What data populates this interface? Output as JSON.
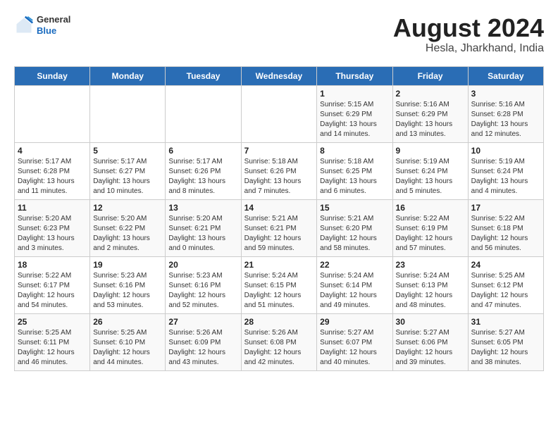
{
  "header": {
    "logo": {
      "general": "General",
      "blue": "Blue"
    },
    "title": "August 2024",
    "location": "Hesla, Jharkhand, India"
  },
  "weekdays": [
    "Sunday",
    "Monday",
    "Tuesday",
    "Wednesday",
    "Thursday",
    "Friday",
    "Saturday"
  ],
  "weeks": [
    [
      {
        "day": "",
        "info": ""
      },
      {
        "day": "",
        "info": ""
      },
      {
        "day": "",
        "info": ""
      },
      {
        "day": "",
        "info": ""
      },
      {
        "day": "1",
        "info": "Sunrise: 5:15 AM\nSunset: 6:29 PM\nDaylight: 13 hours\nand 14 minutes."
      },
      {
        "day": "2",
        "info": "Sunrise: 5:16 AM\nSunset: 6:29 PM\nDaylight: 13 hours\nand 13 minutes."
      },
      {
        "day": "3",
        "info": "Sunrise: 5:16 AM\nSunset: 6:28 PM\nDaylight: 13 hours\nand 12 minutes."
      }
    ],
    [
      {
        "day": "4",
        "info": "Sunrise: 5:17 AM\nSunset: 6:28 PM\nDaylight: 13 hours\nand 11 minutes."
      },
      {
        "day": "5",
        "info": "Sunrise: 5:17 AM\nSunset: 6:27 PM\nDaylight: 13 hours\nand 10 minutes."
      },
      {
        "day": "6",
        "info": "Sunrise: 5:17 AM\nSunset: 6:26 PM\nDaylight: 13 hours\nand 8 minutes."
      },
      {
        "day": "7",
        "info": "Sunrise: 5:18 AM\nSunset: 6:26 PM\nDaylight: 13 hours\nand 7 minutes."
      },
      {
        "day": "8",
        "info": "Sunrise: 5:18 AM\nSunset: 6:25 PM\nDaylight: 13 hours\nand 6 minutes."
      },
      {
        "day": "9",
        "info": "Sunrise: 5:19 AM\nSunset: 6:24 PM\nDaylight: 13 hours\nand 5 minutes."
      },
      {
        "day": "10",
        "info": "Sunrise: 5:19 AM\nSunset: 6:24 PM\nDaylight: 13 hours\nand 4 minutes."
      }
    ],
    [
      {
        "day": "11",
        "info": "Sunrise: 5:20 AM\nSunset: 6:23 PM\nDaylight: 13 hours\nand 3 minutes."
      },
      {
        "day": "12",
        "info": "Sunrise: 5:20 AM\nSunset: 6:22 PM\nDaylight: 13 hours\nand 2 minutes."
      },
      {
        "day": "13",
        "info": "Sunrise: 5:20 AM\nSunset: 6:21 PM\nDaylight: 13 hours\nand 0 minutes."
      },
      {
        "day": "14",
        "info": "Sunrise: 5:21 AM\nSunset: 6:21 PM\nDaylight: 12 hours\nand 59 minutes."
      },
      {
        "day": "15",
        "info": "Sunrise: 5:21 AM\nSunset: 6:20 PM\nDaylight: 12 hours\nand 58 minutes."
      },
      {
        "day": "16",
        "info": "Sunrise: 5:22 AM\nSunset: 6:19 PM\nDaylight: 12 hours\nand 57 minutes."
      },
      {
        "day": "17",
        "info": "Sunrise: 5:22 AM\nSunset: 6:18 PM\nDaylight: 12 hours\nand 56 minutes."
      }
    ],
    [
      {
        "day": "18",
        "info": "Sunrise: 5:22 AM\nSunset: 6:17 PM\nDaylight: 12 hours\nand 54 minutes."
      },
      {
        "day": "19",
        "info": "Sunrise: 5:23 AM\nSunset: 6:16 PM\nDaylight: 12 hours\nand 53 minutes."
      },
      {
        "day": "20",
        "info": "Sunrise: 5:23 AM\nSunset: 6:16 PM\nDaylight: 12 hours\nand 52 minutes."
      },
      {
        "day": "21",
        "info": "Sunrise: 5:24 AM\nSunset: 6:15 PM\nDaylight: 12 hours\nand 51 minutes."
      },
      {
        "day": "22",
        "info": "Sunrise: 5:24 AM\nSunset: 6:14 PM\nDaylight: 12 hours\nand 49 minutes."
      },
      {
        "day": "23",
        "info": "Sunrise: 5:24 AM\nSunset: 6:13 PM\nDaylight: 12 hours\nand 48 minutes."
      },
      {
        "day": "24",
        "info": "Sunrise: 5:25 AM\nSunset: 6:12 PM\nDaylight: 12 hours\nand 47 minutes."
      }
    ],
    [
      {
        "day": "25",
        "info": "Sunrise: 5:25 AM\nSunset: 6:11 PM\nDaylight: 12 hours\nand 46 minutes."
      },
      {
        "day": "26",
        "info": "Sunrise: 5:25 AM\nSunset: 6:10 PM\nDaylight: 12 hours\nand 44 minutes."
      },
      {
        "day": "27",
        "info": "Sunrise: 5:26 AM\nSunset: 6:09 PM\nDaylight: 12 hours\nand 43 minutes."
      },
      {
        "day": "28",
        "info": "Sunrise: 5:26 AM\nSunset: 6:08 PM\nDaylight: 12 hours\nand 42 minutes."
      },
      {
        "day": "29",
        "info": "Sunrise: 5:27 AM\nSunset: 6:07 PM\nDaylight: 12 hours\nand 40 minutes."
      },
      {
        "day": "30",
        "info": "Sunrise: 5:27 AM\nSunset: 6:06 PM\nDaylight: 12 hours\nand 39 minutes."
      },
      {
        "day": "31",
        "info": "Sunrise: 5:27 AM\nSunset: 6:05 PM\nDaylight: 12 hours\nand 38 minutes."
      }
    ]
  ]
}
